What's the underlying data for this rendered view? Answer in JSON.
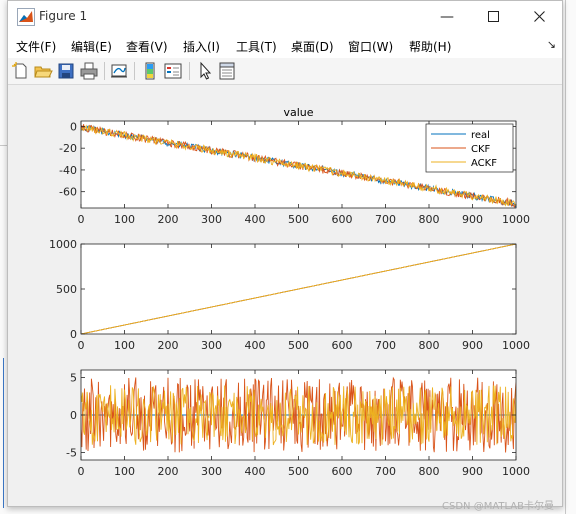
{
  "window": {
    "title": "Figure 1"
  },
  "menu": [
    "文件(F)",
    "编辑(E)",
    "查看(V)",
    "插入(I)",
    "工具(T)",
    "桌面(D)",
    "窗口(W)",
    "帮助(H)"
  ],
  "toolbar": {
    "icons": [
      "new-figure-icon",
      "open-file-icon",
      "save-icon",
      "print-icon",
      "link-plot-icon",
      "insert-colorbar-icon",
      "insert-legend-icon",
      "edit-plot-icon",
      "property-inspector-icon"
    ]
  },
  "watermark": "CSDN @MATLAB卡尔曼",
  "chart_data": [
    {
      "type": "line",
      "title": "value",
      "xlim": [
        0,
        1000
      ],
      "ylim": [
        -75,
        5
      ],
      "xticks": [
        0,
        100,
        200,
        300,
        400,
        500,
        600,
        700,
        800,
        900,
        1000
      ],
      "yticks": [
        0,
        -20,
        -40,
        -60
      ],
      "legend": {
        "position": "top-right",
        "entries": [
          "real",
          "CKF",
          "ACKF"
        ]
      },
      "series": [
        {
          "name": "real",
          "color": "#0072bd",
          "trend": {
            "x": [
              0,
              1000
            ],
            "y": [
              -1,
              -71
            ]
          },
          "noise_amplitude": 3
        },
        {
          "name": "CKF",
          "color": "#d95319",
          "trend": {
            "x": [
              0,
              1000
            ],
            "y": [
              -1,
              -71
            ]
          },
          "noise_amplitude": 3.5
        },
        {
          "name": "ACKF",
          "color": "#edb120",
          "trend": {
            "x": [
              0,
              1000
            ],
            "y": [
              -1,
              -71
            ]
          },
          "noise_amplitude": 3.5
        }
      ]
    },
    {
      "type": "line",
      "title": "",
      "xlim": [
        0,
        1000
      ],
      "ylim": [
        0,
        1000
      ],
      "xticks": [
        0,
        100,
        200,
        300,
        400,
        500,
        600,
        700,
        800,
        900,
        1000
      ],
      "yticks": [
        0,
        500,
        1000
      ],
      "series": [
        {
          "name": "real",
          "color": "#0072bd",
          "trend": {
            "x": [
              0,
              1000
            ],
            "y": [
              0,
              1000
            ]
          },
          "noise_amplitude": 0
        },
        {
          "name": "CKF",
          "color": "#d95319",
          "trend": {
            "x": [
              0,
              1000
            ],
            "y": [
              0,
              1000
            ]
          },
          "noise_amplitude": 0
        },
        {
          "name": "ACKF",
          "color": "#edb120",
          "trend": {
            "x": [
              0,
              1000
            ],
            "y": [
              0,
              1000
            ]
          },
          "noise_amplitude": 0
        }
      ]
    },
    {
      "type": "line",
      "title": "",
      "xlim": [
        0,
        1000
      ],
      "ylim": [
        -6,
        6
      ],
      "xticks": [
        0,
        100,
        200,
        300,
        400,
        500,
        600,
        700,
        800,
        900,
        1000
      ],
      "yticks": [
        5,
        0,
        -5
      ],
      "series": [
        {
          "name": "real",
          "color": "#0072bd",
          "trend": {
            "x": [
              0,
              1000
            ],
            "y": [
              0,
              0
            ]
          },
          "noise_amplitude": 0
        },
        {
          "name": "CKF",
          "color": "#d95319",
          "trend": {
            "x": [
              0,
              1000
            ],
            "y": [
              0,
              0
            ]
          },
          "noise_amplitude": 5
        },
        {
          "name": "ACKF",
          "color": "#edb120",
          "trend": {
            "x": [
              0,
              1000
            ],
            "y": [
              0,
              0
            ]
          },
          "noise_amplitude": 4
        }
      ]
    }
  ]
}
